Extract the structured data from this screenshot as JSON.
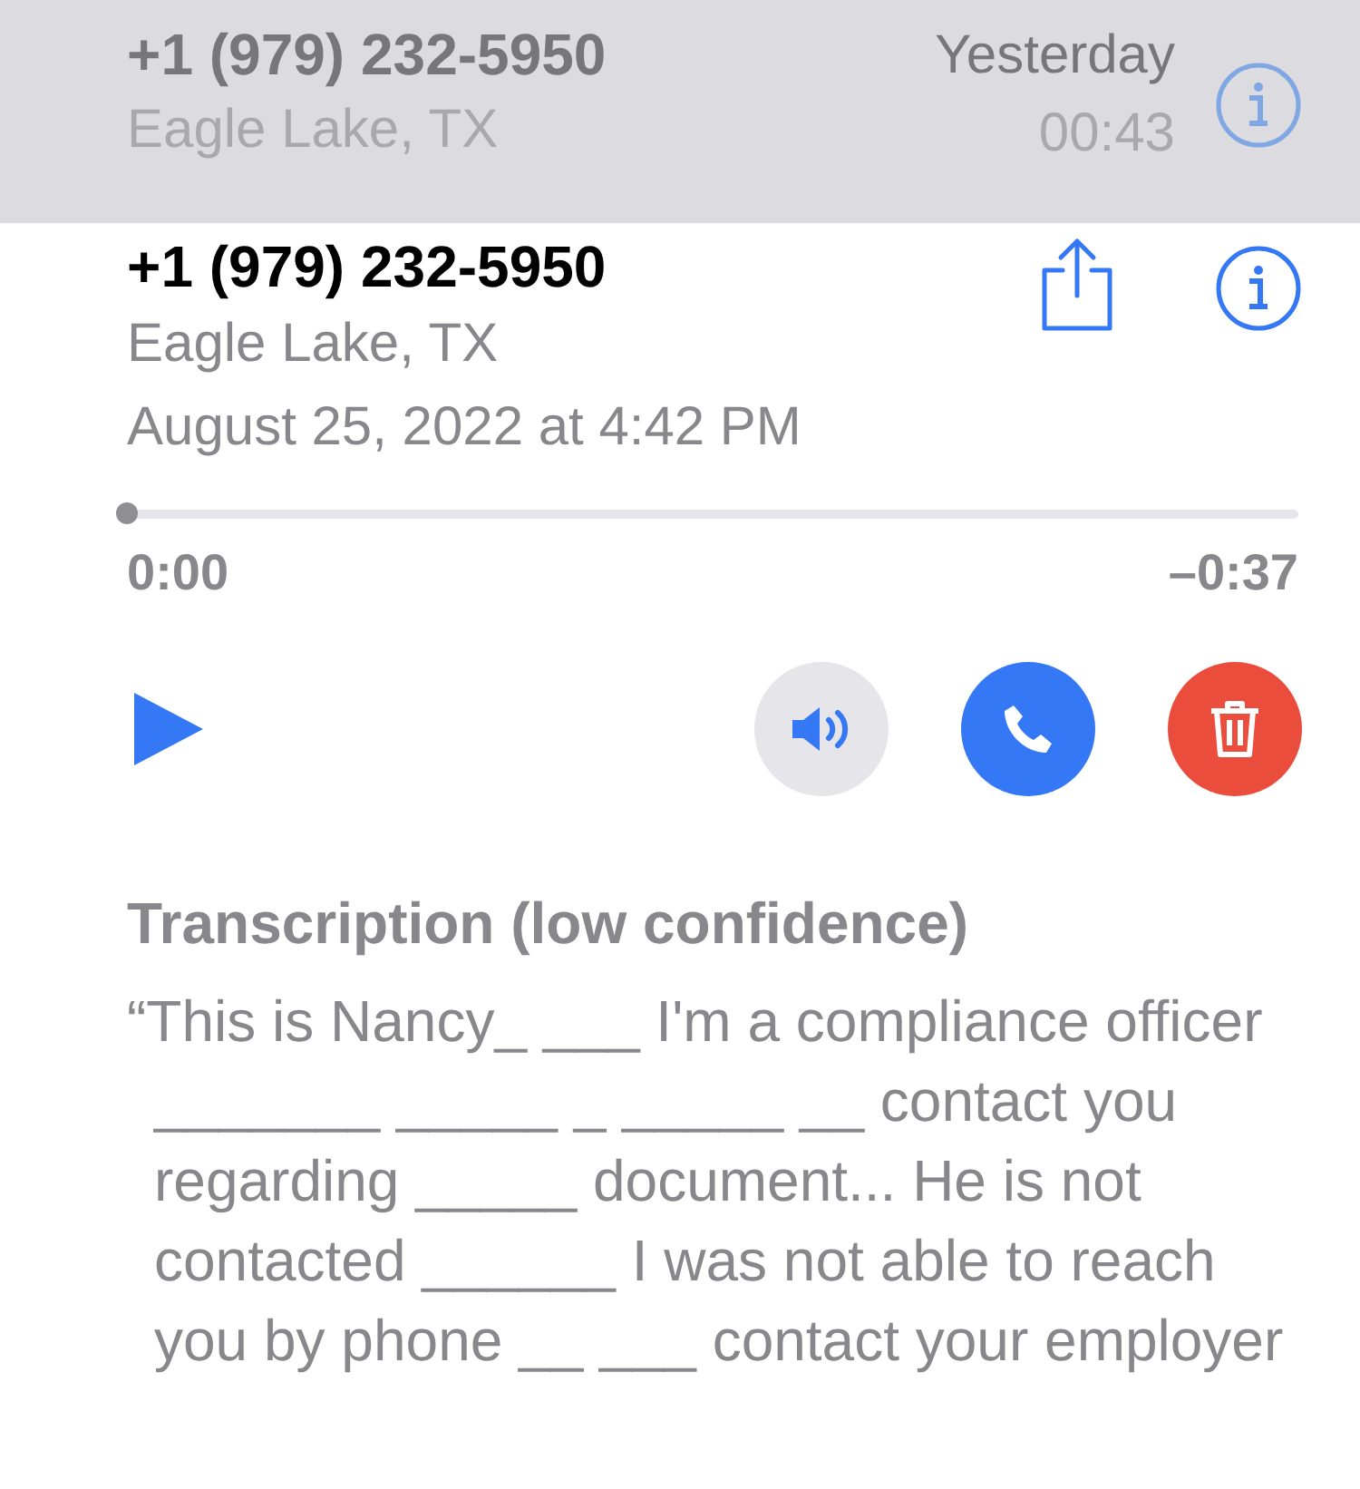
{
  "list_row": {
    "number": "+1 (979) 232-5950",
    "location": "Eagle Lake, TX",
    "date": "Yesterday",
    "duration": "00:43"
  },
  "detail": {
    "number": "+1 (979) 232-5950",
    "location": "Eagle Lake, TX",
    "timestamp": "August 25, 2022 at 4:42 PM"
  },
  "playback": {
    "level": 0,
    "elapsed": "0:00",
    "remaining": "–0:37",
    "speaker_on": false
  },
  "transcription": {
    "title": "Transcription (low confidence)",
    "text": "“This is Nancy_ ___ I'm a compliance officer _______ _____ _ _____ __ contact you regarding _____ document... He is not contacted ______ I was not able to reach you by phone __ ___ contact your employer"
  }
}
